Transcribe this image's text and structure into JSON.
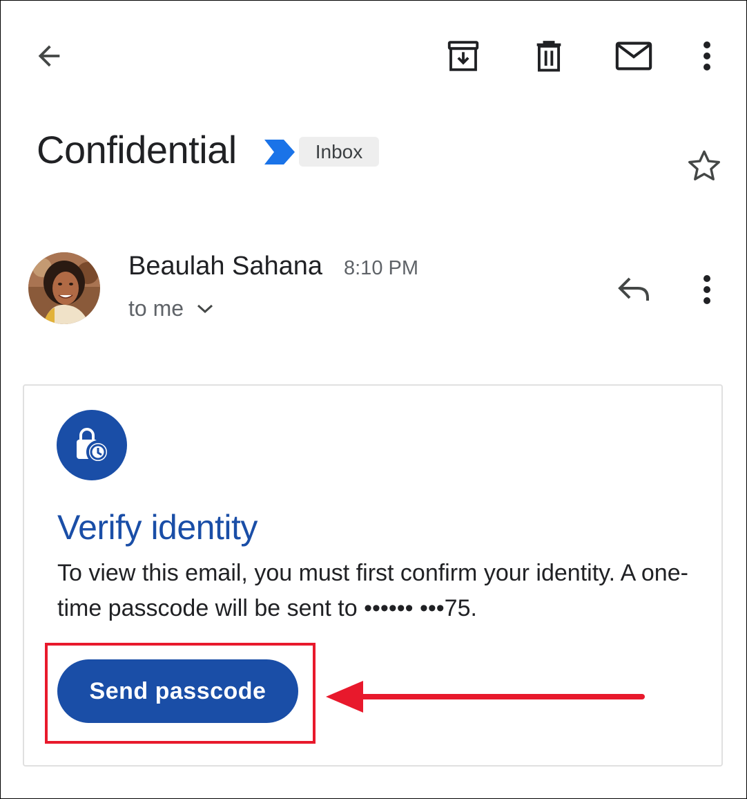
{
  "toolbar": {
    "back_icon": "arrow-back-icon",
    "archive_icon": "archive-icon",
    "delete_icon": "delete-icon",
    "mark_unread_icon": "mail-icon",
    "more_icon": "more-vert-icon"
  },
  "subject": {
    "title": "Confidential",
    "importance_icon": "importance-marker-icon",
    "label": "Inbox",
    "star_icon": "star-outline-icon"
  },
  "message_header": {
    "sender_name": "Beaulah Sahana",
    "time": "8:10 PM",
    "recipient": "to me",
    "reply_icon": "reply-icon",
    "more_icon": "more-vert-icon"
  },
  "verify_card": {
    "icon": "lock-clock-icon",
    "title": "Verify identity",
    "body": "To view this email, you must first confirm your identity. A one-time passcode will be sent to •••••• •••75.",
    "button_label": "Send passcode"
  },
  "colors": {
    "accent": "#1a4ea7",
    "annotation": "#e8192c",
    "chip_bg": "#eeeeee",
    "importance": "#1a73e8"
  }
}
